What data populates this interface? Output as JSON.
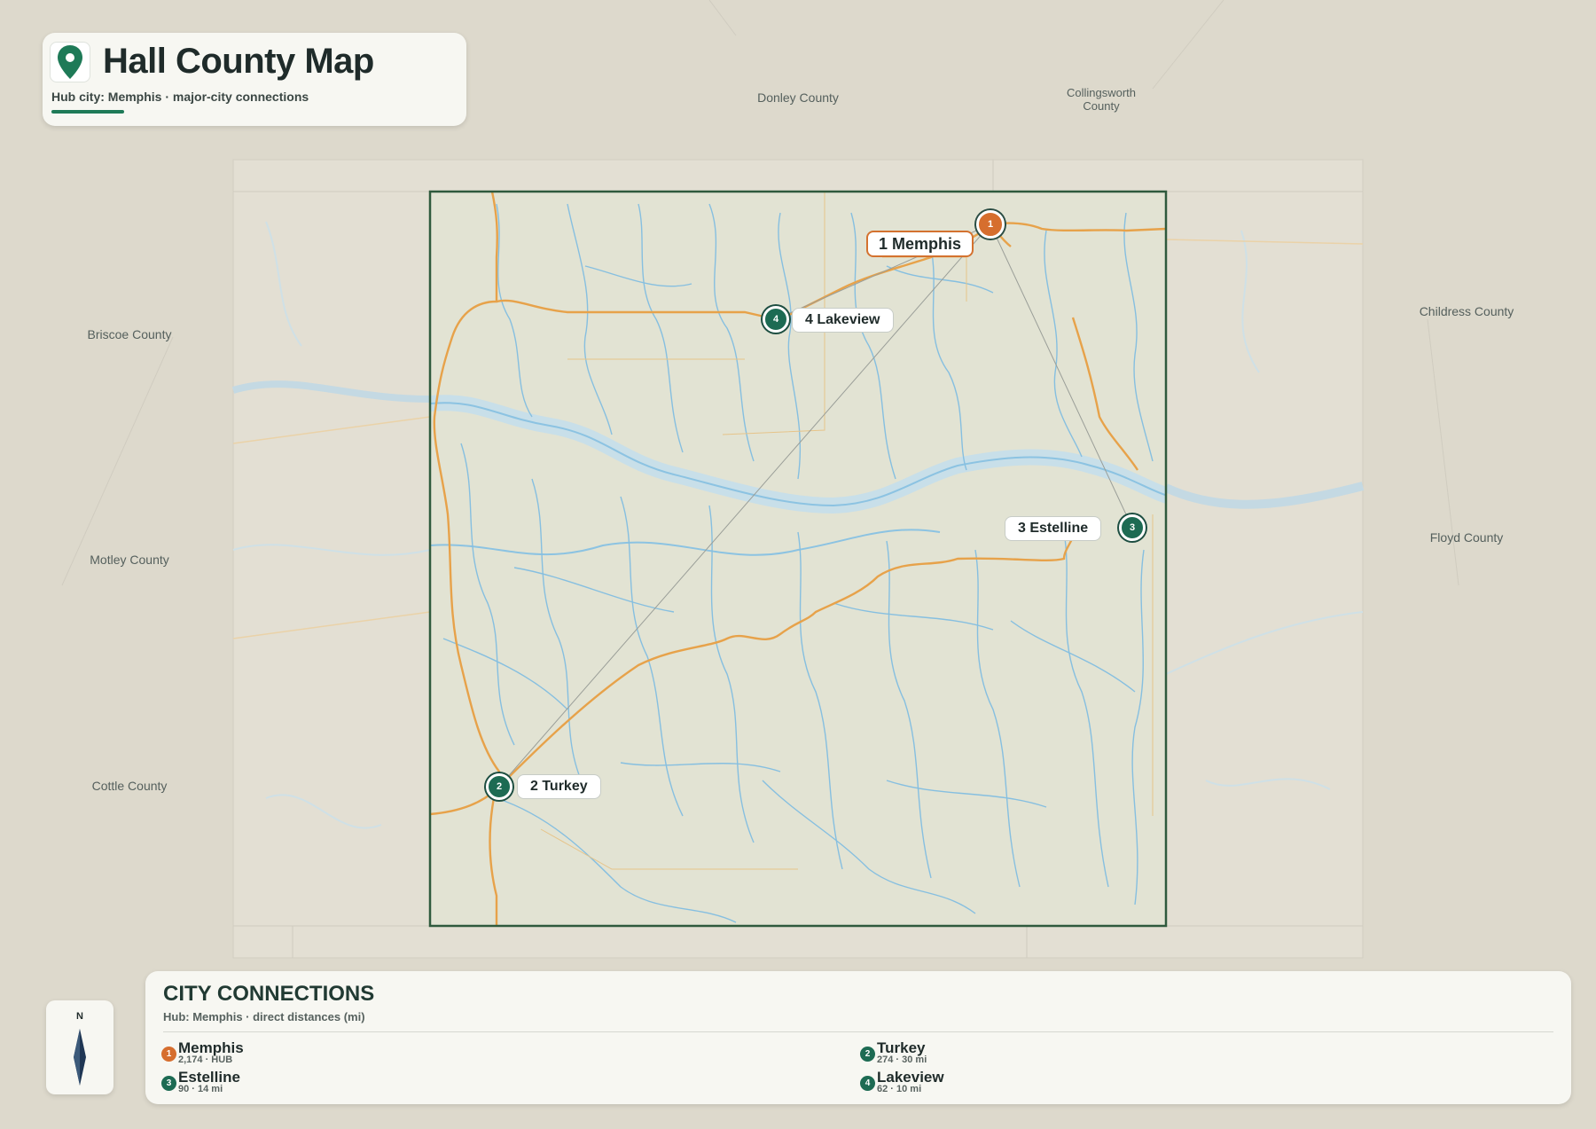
{
  "header": {
    "title": "Hall County Map",
    "subtitle": "Hub city: Memphis · major-city connections",
    "icon": "location-pin-icon",
    "accent_color": "#1e7a57"
  },
  "neighbors": {
    "donley": "Donley County",
    "collingsworth": "Collingsworth County",
    "childress": "Childress County",
    "briscoe": "Briscoe County",
    "motley": "Motley County",
    "floyd": "Floyd County",
    "cottle": "Cottle County"
  },
  "cities": {
    "memphis": {
      "label": "1 Memphis",
      "number": "1"
    },
    "turkey": {
      "label": "2 Turkey",
      "number": "2"
    },
    "estelline": {
      "label": "3 Estelline",
      "number": "3"
    },
    "lakeview": {
      "label": "4 Lakeview",
      "number": "4"
    }
  },
  "compass": {
    "north_label": "N",
    "icon": "compass-needle-icon"
  },
  "legend": {
    "title": "CITY CONNECTIONS",
    "subtitle": "Hub: Memphis · direct distances (mi)",
    "items": [
      {
        "number": "1",
        "name": "Memphis",
        "detail": "2,174 · HUB"
      },
      {
        "number": "2",
        "name": "Turkey",
        "detail": "274 · 30 mi"
      },
      {
        "number": "3",
        "name": "Estelline",
        "detail": "90 · 14 mi"
      },
      {
        "number": "4",
        "name": "Lakeview",
        "detail": "62 · 10 mi"
      }
    ]
  },
  "colors": {
    "hub": "#d66e2e",
    "city": "#1d6b53",
    "county_border": "#2f5a3d",
    "roads": "#e7a24a",
    "water": "#7cb8de"
  }
}
